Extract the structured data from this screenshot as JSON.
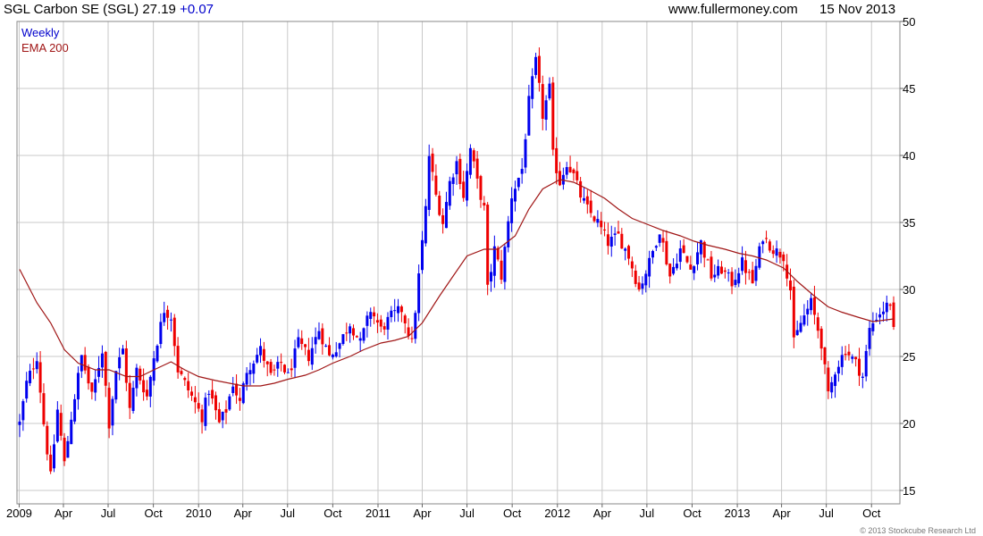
{
  "header": {
    "title": "SGL Carbon SE (SGL) 27.19",
    "change": "+0.07",
    "site": "www.fullermoney.com",
    "date": "15 Nov 2013"
  },
  "legend": {
    "weekly": "Weekly",
    "ema": "EMA 200"
  },
  "copyright": "© 2013 Stockcube Research Ltd",
  "colors": {
    "up": "#0000ee",
    "down": "#ee0000",
    "ema": "#a01616",
    "grid": "#c8c8c8"
  },
  "chart_data": {
    "type": "candlestick",
    "title": "SGL Carbon SE (SGL) 27.19 +0.07",
    "interval": "Weekly",
    "grid": true,
    "ylim": [
      14,
      50
    ],
    "yticks": [
      15,
      20,
      25,
      30,
      35,
      40,
      45,
      50
    ],
    "xlim": [
      "2009-01-02",
      "2013-11-15"
    ],
    "xticks": [
      {
        "label": "2009",
        "date": "2009-01-01"
      },
      {
        "label": "Apr",
        "date": "2009-04-01"
      },
      {
        "label": "Jul",
        "date": "2009-07-01"
      },
      {
        "label": "Oct",
        "date": "2009-10-01"
      },
      {
        "label": "2010",
        "date": "2010-01-01"
      },
      {
        "label": "Apr",
        "date": "2010-04-01"
      },
      {
        "label": "Jul",
        "date": "2010-07-01"
      },
      {
        "label": "Oct",
        "date": "2010-10-01"
      },
      {
        "label": "2011",
        "date": "2011-01-01"
      },
      {
        "label": "Apr",
        "date": "2011-04-01"
      },
      {
        "label": "Jul",
        "date": "2011-07-01"
      },
      {
        "label": "Oct",
        "date": "2011-10-01"
      },
      {
        "label": "2012",
        "date": "2012-01-01"
      },
      {
        "label": "Apr",
        "date": "2012-04-01"
      },
      {
        "label": "Jul",
        "date": "2012-07-01"
      },
      {
        "label": "Oct",
        "date": "2012-10-01"
      },
      {
        "label": "2013",
        "date": "2013-01-01"
      },
      {
        "label": "Apr",
        "date": "2013-04-01"
      },
      {
        "label": "Jul",
        "date": "2013-07-01"
      },
      {
        "label": "Oct",
        "date": "2013-10-01"
      }
    ],
    "close_path": [
      [
        "2009-01-02",
        20.0
      ],
      [
        "2009-01-16",
        23.0
      ],
      [
        "2009-02-06",
        25.0
      ],
      [
        "2009-02-20",
        20.0
      ],
      [
        "2009-03-06",
        16.0
      ],
      [
        "2009-03-20",
        21.0
      ],
      [
        "2009-04-03",
        17.0
      ],
      [
        "2009-04-17",
        20.5
      ],
      [
        "2009-05-08",
        25.0
      ],
      [
        "2009-05-29",
        22.0
      ],
      [
        "2009-06-19",
        25.5
      ],
      [
        "2009-07-03",
        20.0
      ],
      [
        "2009-07-17",
        24.0
      ],
      [
        "2009-07-31",
        25.5
      ],
      [
        "2009-08-14",
        21.0
      ],
      [
        "2009-08-28",
        24.0
      ],
      [
        "2009-09-18",
        22.0
      ],
      [
        "2009-10-02",
        25.0
      ],
      [
        "2009-10-23",
        28.5
      ],
      [
        "2009-11-06",
        28.0
      ],
      [
        "2009-11-20",
        24.0
      ],
      [
        "2009-12-04",
        23.0
      ],
      [
        "2009-12-25",
        21.5
      ],
      [
        "2010-01-08",
        20.5
      ],
      [
        "2010-01-22",
        22.5
      ],
      [
        "2010-02-12",
        20.0
      ],
      [
        "2010-02-26",
        21.0
      ],
      [
        "2010-03-12",
        23.0
      ],
      [
        "2010-03-26",
        21.5
      ],
      [
        "2010-04-09",
        24.0
      ],
      [
        "2010-05-07",
        25.5
      ],
      [
        "2010-05-28",
        23.5
      ],
      [
        "2010-06-18",
        24.5
      ],
      [
        "2010-07-02",
        23.5
      ],
      [
        "2010-07-23",
        26.0
      ],
      [
        "2010-08-13",
        25.0
      ],
      [
        "2010-09-03",
        27.0
      ],
      [
        "2010-09-24",
        25.0
      ],
      [
        "2010-10-15",
        26.0
      ],
      [
        "2010-11-05",
        27.5
      ],
      [
        "2010-11-26",
        26.0
      ],
      [
        "2010-12-17",
        28.5
      ],
      [
        "2011-01-07",
        27.0
      ],
      [
        "2011-01-28",
        28.0
      ],
      [
        "2011-02-18",
        28.5
      ],
      [
        "2011-03-11",
        26.0
      ],
      [
        "2011-03-25",
        31.0
      ],
      [
        "2011-04-08",
        36.0
      ],
      [
        "2011-04-15",
        40.0
      ],
      [
        "2011-04-29",
        37.0
      ],
      [
        "2011-05-13",
        35.0
      ],
      [
        "2011-05-27",
        38.0
      ],
      [
        "2011-06-10",
        39.5
      ],
      [
        "2011-06-24",
        37.0
      ],
      [
        "2011-07-08",
        40.5
      ],
      [
        "2011-07-22",
        38.0
      ],
      [
        "2011-08-05",
        36.0
      ],
      [
        "2011-08-12",
        30.0
      ],
      [
        "2011-08-26",
        33.0
      ],
      [
        "2011-09-09",
        31.0
      ],
      [
        "2011-09-30",
        37.0
      ],
      [
        "2011-10-21",
        39.0
      ],
      [
        "2011-11-04",
        44.0
      ],
      [
        "2011-11-18",
        47.0
      ],
      [
        "2011-12-02",
        43.0
      ],
      [
        "2011-12-16",
        45.0
      ],
      [
        "2011-12-23",
        40.0
      ],
      [
        "2012-01-06",
        38.0
      ],
      [
        "2012-01-20",
        39.5
      ],
      [
        "2012-02-03",
        38.5
      ],
      [
        "2012-02-17",
        37.0
      ],
      [
        "2012-03-02",
        36.0
      ],
      [
        "2012-03-23",
        35.0
      ],
      [
        "2012-04-13",
        33.5
      ],
      [
        "2012-05-04",
        34.0
      ],
      [
        "2012-05-25",
        32.5
      ],
      [
        "2012-06-15",
        30.0
      ],
      [
        "2012-07-06",
        32.0
      ],
      [
        "2012-07-27",
        34.5
      ],
      [
        "2012-08-17",
        31.0
      ],
      [
        "2012-09-07",
        33.0
      ],
      [
        "2012-09-28",
        31.5
      ],
      [
        "2012-10-19",
        33.5
      ],
      [
        "2012-11-09",
        31.0
      ],
      [
        "2012-11-30",
        31.5
      ],
      [
        "2012-12-21",
        30.5
      ],
      [
        "2013-01-11",
        32.0
      ],
      [
        "2013-02-01",
        30.5
      ],
      [
        "2013-02-22",
        34.0
      ],
      [
        "2013-03-15",
        33.0
      ],
      [
        "2013-04-05",
        32.5
      ],
      [
        "2013-04-19",
        30.0
      ],
      [
        "2013-04-26",
        26.0
      ],
      [
        "2013-05-10",
        27.5
      ],
      [
        "2013-05-31",
        29.0
      ],
      [
        "2013-06-21",
        26.0
      ],
      [
        "2013-07-05",
        22.0
      ],
      [
        "2013-07-19",
        24.0
      ],
      [
        "2013-08-09",
        25.5
      ],
      [
        "2013-08-30",
        24.5
      ],
      [
        "2013-09-13",
        23.5
      ],
      [
        "2013-09-27",
        27.0
      ],
      [
        "2013-10-11",
        28.0
      ],
      [
        "2013-10-25",
        28.5
      ],
      [
        "2013-11-08",
        29.0
      ],
      [
        "2013-11-15",
        27.2
      ]
    ],
    "ema_200": [
      [
        "2009-01-02",
        31.5
      ],
      [
        "2009-02-06",
        29.0
      ],
      [
        "2009-03-06",
        27.5
      ],
      [
        "2009-04-03",
        25.5
      ],
      [
        "2009-05-01",
        24.5
      ],
      [
        "2009-06-05",
        24.0
      ],
      [
        "2009-07-03",
        24.0
      ],
      [
        "2009-08-07",
        23.5
      ],
      [
        "2009-09-04",
        23.5
      ],
      [
        "2009-10-02",
        24.0
      ],
      [
        "2009-11-06",
        24.6
      ],
      [
        "2009-12-04",
        24.0
      ],
      [
        "2010-01-01",
        23.5
      ],
      [
        "2010-02-05",
        23.2
      ],
      [
        "2010-03-05",
        23.0
      ],
      [
        "2010-04-02",
        22.8
      ],
      [
        "2010-05-07",
        22.8
      ],
      [
        "2010-06-04",
        23.0
      ],
      [
        "2010-07-02",
        23.3
      ],
      [
        "2010-08-06",
        23.6
      ],
      [
        "2010-09-03",
        24.0
      ],
      [
        "2010-10-01",
        24.5
      ],
      [
        "2010-11-05",
        25.0
      ],
      [
        "2010-12-03",
        25.5
      ],
      [
        "2011-01-07",
        26.0
      ],
      [
        "2011-02-04",
        26.2
      ],
      [
        "2011-03-04",
        26.5
      ],
      [
        "2011-04-01",
        27.5
      ],
      [
        "2011-05-06",
        29.5
      ],
      [
        "2011-06-03",
        31.0
      ],
      [
        "2011-07-01",
        32.5
      ],
      [
        "2011-08-05",
        33.0
      ],
      [
        "2011-09-02",
        33.0
      ],
      [
        "2011-10-07",
        34.0
      ],
      [
        "2011-11-04",
        36.0
      ],
      [
        "2011-12-02",
        37.5
      ],
      [
        "2012-01-06",
        38.2
      ],
      [
        "2012-02-03",
        38.0
      ],
      [
        "2012-03-02",
        37.5
      ],
      [
        "2012-04-06",
        36.8
      ],
      [
        "2012-05-04",
        36.0
      ],
      [
        "2012-06-01",
        35.3
      ],
      [
        "2012-07-06",
        34.8
      ],
      [
        "2012-08-03",
        34.4
      ],
      [
        "2012-09-07",
        34.0
      ],
      [
        "2012-10-05",
        33.6
      ],
      [
        "2012-11-02",
        33.3
      ],
      [
        "2012-12-07",
        33.0
      ],
      [
        "2013-01-04",
        32.7
      ],
      [
        "2013-02-01",
        32.5
      ],
      [
        "2013-03-01",
        32.2
      ],
      [
        "2013-04-05",
        31.6
      ],
      [
        "2013-05-03",
        30.6
      ],
      [
        "2013-06-07",
        29.5
      ],
      [
        "2013-07-05",
        28.7
      ],
      [
        "2013-08-02",
        28.3
      ],
      [
        "2013-09-06",
        27.9
      ],
      [
        "2013-10-04",
        27.6
      ],
      [
        "2013-11-15",
        27.8
      ]
    ]
  }
}
